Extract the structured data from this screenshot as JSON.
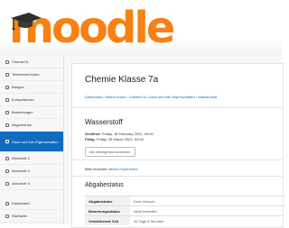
{
  "brand": {
    "name": "moodle",
    "color": "#f98012"
  },
  "sidebar": {
    "items": [
      {
        "label": "Chemie7a",
        "icon": "cap-icon",
        "active": false
      },
      {
        "label": "Teilnehmer/innen",
        "icon": "users-icon",
        "active": false
      },
      {
        "label": "Badges",
        "icon": "badge-icon",
        "active": false
      },
      {
        "label": "Kompetenzen",
        "icon": "check-icon",
        "active": false
      },
      {
        "label": "Bewertungen",
        "icon": "grades-icon",
        "active": false
      },
      {
        "label": "Allgemeines",
        "icon": "folder-icon",
        "active": false
      },
      {
        "label": "Gase und ihre Eigenschaften",
        "icon": "folder-icon",
        "active": true
      },
      {
        "label": "Abschnitt 2",
        "icon": "folder-icon",
        "active": false
      },
      {
        "label": "Abschnitt 3",
        "icon": "folder-icon",
        "active": false
      },
      {
        "label": "Abschnitt 4",
        "icon": "folder-icon",
        "active": false
      }
    ],
    "bottom_items": [
      {
        "label": "Dashboard",
        "icon": "dashboard-icon"
      },
      {
        "label": "Startseite",
        "icon": "home-icon"
      }
    ],
    "active_color": "#0f6cbf"
  },
  "page": {
    "course_title": "Chemie Klasse 7a",
    "breadcrumb": "Dashboard / Meine Kurse / Chemie7a / Gase und ihre Eigenschaften / Wasserstoff",
    "assignment_title": "Wasserstoff",
    "opened_label": "Geöffnet:",
    "opened_value": "Friday, 18 February 2022, 00:00",
    "due_label": "Fällig:",
    "due_value": "Friday, 25 March 2022, 00:00",
    "done_button": "Als erledigt kennzeichnen",
    "intro_text": "Bitte beachtet",
    "intro_link": "dieses Experiment.",
    "status_heading": "Abgabestatus",
    "status_rows": [
      {
        "key": "Abgabestatus",
        "value": "Kein Versuch"
      },
      {
        "key": "Bewertungsstatus",
        "value": "Nicht bewertet"
      },
      {
        "key": "Verbleibende Zeit",
        "value": "34 Tage 8 Stunden"
      }
    ]
  }
}
